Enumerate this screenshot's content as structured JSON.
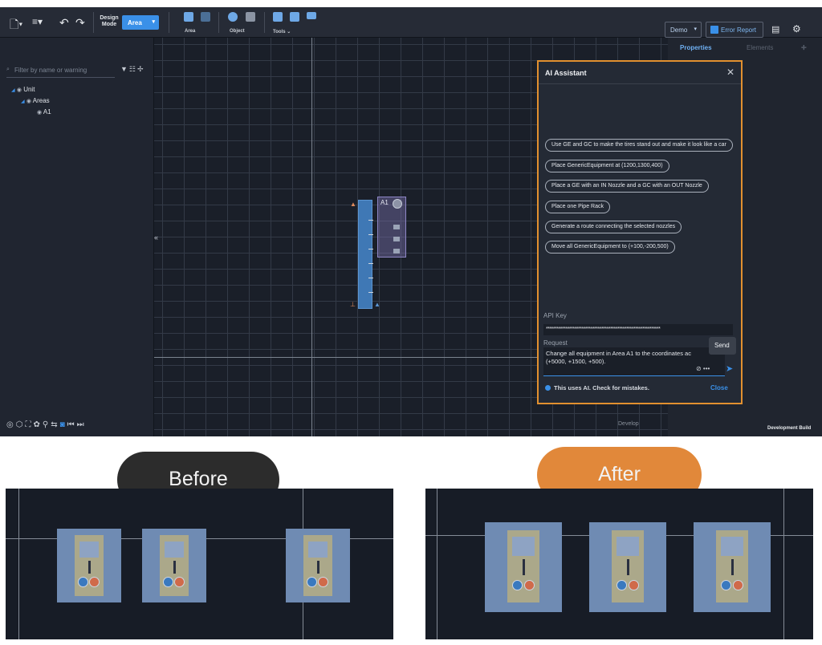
{
  "toolbar": {
    "design_mode_label": "Design Mode",
    "mode_value": "Area",
    "groups": [
      {
        "label": "Area"
      },
      {
        "label": "Object"
      },
      {
        "label": "Tools ⌄"
      }
    ],
    "demo_label": "Demo",
    "error_report_label": "Error Report"
  },
  "left_panel": {
    "filter_placeholder": "Filter by name or warning",
    "tree": [
      {
        "label": "Unit",
        "level": 0
      },
      {
        "label": "Areas",
        "level": 1
      },
      {
        "label": "A1",
        "level": 2
      }
    ]
  },
  "viewport": {
    "area_label": "A1",
    "develop_label": "Develop",
    "collapse_label": "«"
  },
  "right_panel": {
    "tab_properties": "Properties",
    "tab_elements": "Elements",
    "dev_build_label": "Development Build"
  },
  "ai_assistant": {
    "title": "AI Assistant",
    "suggestions": [
      "Use GE and GC to make the tires stand out and make it look like a car",
      "Place GenericEquipment at (1200,1300,400)",
      "Place a GE with an IN Nozzle and a GC with an OUT Nozzle",
      "Place one Pipe Rack",
      "Generate a route connecting the selected nozzles",
      "Move all GenericEquipment to (+100,-200,500)"
    ],
    "api_key_label": "API Key",
    "api_key_value": "****************************************************************",
    "request_label": "Request",
    "request_line1": "Change all equipment in Area A1 to the coordinates ac",
    "request_line2": "(+5000, +1500, +500).",
    "send_tooltip": "Send",
    "disclaimer": "This uses AI. Check for mistakes.",
    "close_label": "Close"
  },
  "comparison": {
    "before_label": "Before",
    "after_label": "After"
  },
  "colors": {
    "accent": "#3a90e8",
    "highlight": "#e2902f",
    "after_pill": "#e1883a",
    "before_pill": "#2c2c2c"
  }
}
